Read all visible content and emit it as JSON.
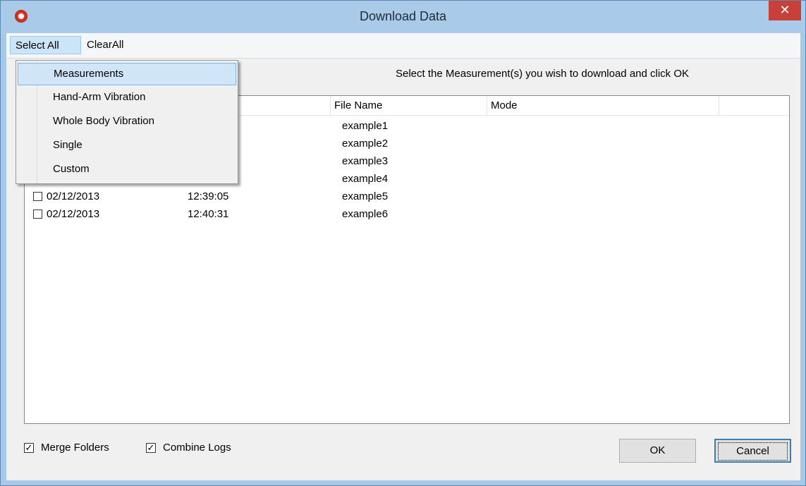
{
  "window": {
    "title": "Download Data",
    "close_glyph": "✕"
  },
  "menubar": {
    "select_all": "Select All",
    "clear_all": "ClearAll"
  },
  "dropdown": {
    "items": [
      {
        "label": "Measurements",
        "highlighted": true
      },
      {
        "label": "Hand-Arm Vibration",
        "highlighted": false
      },
      {
        "label": "Whole Body Vibration",
        "highlighted": false
      },
      {
        "label": "Single",
        "highlighted": false
      },
      {
        "label": "Custom",
        "highlighted": false
      }
    ]
  },
  "instruction": "Select the Measurement(s) you wish to download and click OK",
  "list": {
    "columns": [
      "File Name",
      "Mode"
    ],
    "rows": [
      {
        "date": "",
        "time": "",
        "file": "example1",
        "mode": ""
      },
      {
        "date": "",
        "time": "",
        "file": "example2",
        "mode": ""
      },
      {
        "date": "",
        "time": "",
        "file": "example3",
        "mode": ""
      },
      {
        "date": "",
        "time": "",
        "file": "example4",
        "mode": ""
      },
      {
        "date": "02/12/2013",
        "time": "12:39:05",
        "file": "example5",
        "mode": ""
      },
      {
        "date": "02/12/2013",
        "time": "12:40:31",
        "file": "example6",
        "mode": ""
      }
    ]
  },
  "footer": {
    "merge_folders": {
      "label": "Merge Folders",
      "checked": true
    },
    "combine_logs": {
      "label": "Combine Logs",
      "checked": true
    },
    "ok_label": "OK",
    "cancel_label": "Cancel"
  },
  "colors": {
    "titlebar": "#a9cbe9",
    "close_button": "#c7403a",
    "menu_highlight": "#cce4f7"
  }
}
